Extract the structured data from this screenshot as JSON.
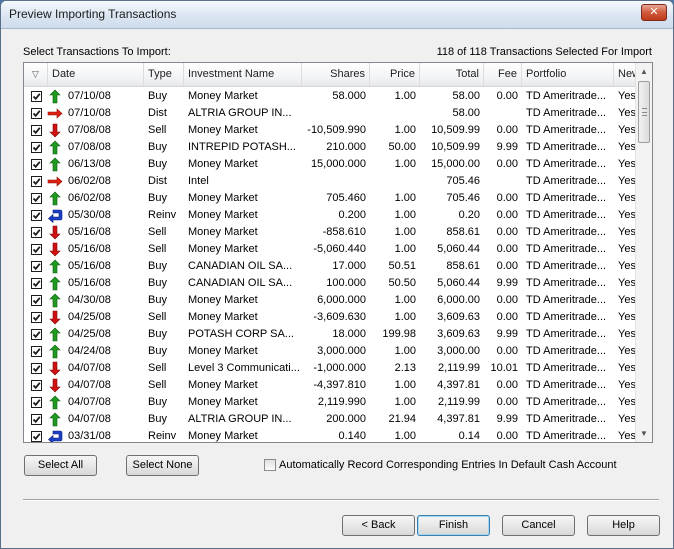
{
  "window": {
    "title": "Preview Importing Transactions",
    "close_label": "✕"
  },
  "labels": {
    "select_prompt": "Select Transactions To Import:",
    "selected_count": "118 of 118 Transactions Selected For Import"
  },
  "columns": [
    "Date",
    "Type",
    "Investment Name",
    "Shares",
    "Price",
    "Total",
    "Fee",
    "Portfolio",
    "New..."
  ],
  "rows": [
    {
      "date": "07/10/08",
      "type": "Buy",
      "icon": "buy-up-arrow-icon",
      "name": "Money Market",
      "shares": "58.000",
      "price": "1.00",
      "total": "58.00",
      "fee": "0.00",
      "portfolio": "TD Ameritrade...",
      "new": "Yes ..."
    },
    {
      "date": "07/10/08",
      "type": "Dist",
      "icon": "dist-right-arrow-icon",
      "name": "ALTRIA GROUP IN...",
      "shares": "",
      "price": "",
      "total": "58.00",
      "fee": "",
      "portfolio": "TD Ameritrade...",
      "new": "Yes ..."
    },
    {
      "date": "07/08/08",
      "type": "Sell",
      "icon": "sell-down-arrow-icon",
      "name": "Money Market",
      "shares": "-10,509.990",
      "price": "1.00",
      "total": "10,509.99",
      "fee": "0.00",
      "portfolio": "TD Ameritrade...",
      "new": "Yes ..."
    },
    {
      "date": "07/08/08",
      "type": "Buy",
      "icon": "buy-up-arrow-icon",
      "name": "INTREPID POTASH...",
      "shares": "210.000",
      "price": "50.00",
      "total": "10,509.99",
      "fee": "9.99",
      "portfolio": "TD Ameritrade...",
      "new": "Yes ..."
    },
    {
      "date": "06/13/08",
      "type": "Buy",
      "icon": "buy-up-arrow-icon",
      "name": "Money Market",
      "shares": "15,000.000",
      "price": "1.00",
      "total": "15,000.00",
      "fee": "0.00",
      "portfolio": "TD Ameritrade...",
      "new": "Yes ..."
    },
    {
      "date": "06/02/08",
      "type": "Dist",
      "icon": "dist-right-arrow-icon",
      "name": "Intel",
      "shares": "",
      "price": "",
      "total": "705.46",
      "fee": "",
      "portfolio": "TD Ameritrade...",
      "new": "Yes ..."
    },
    {
      "date": "06/02/08",
      "type": "Buy",
      "icon": "buy-up-arrow-icon",
      "name": "Money Market",
      "shares": "705.460",
      "price": "1.00",
      "total": "705.46",
      "fee": "0.00",
      "portfolio": "TD Ameritrade...",
      "new": "Yes ..."
    },
    {
      "date": "05/30/08",
      "type": "Reinv",
      "icon": "reinvest-arrow-icon",
      "name": "Money Market",
      "shares": "0.200",
      "price": "1.00",
      "total": "0.20",
      "fee": "0.00",
      "portfolio": "TD Ameritrade...",
      "new": "Yes ..."
    },
    {
      "date": "05/16/08",
      "type": "Sell",
      "icon": "sell-down-arrow-icon",
      "name": "Money Market",
      "shares": "-858.610",
      "price": "1.00",
      "total": "858.61",
      "fee": "0.00",
      "portfolio": "TD Ameritrade...",
      "new": "Yes ..."
    },
    {
      "date": "05/16/08",
      "type": "Sell",
      "icon": "sell-down-arrow-icon",
      "name": "Money Market",
      "shares": "-5,060.440",
      "price": "1.00",
      "total": "5,060.44",
      "fee": "0.00",
      "portfolio": "TD Ameritrade...",
      "new": "Yes ..."
    },
    {
      "date": "05/16/08",
      "type": "Buy",
      "icon": "buy-up-arrow-icon",
      "name": "CANADIAN OIL SA...",
      "shares": "17.000",
      "price": "50.51",
      "total": "858.61",
      "fee": "0.00",
      "portfolio": "TD Ameritrade...",
      "new": "Yes ..."
    },
    {
      "date": "05/16/08",
      "type": "Buy",
      "icon": "buy-up-arrow-icon",
      "name": "CANADIAN OIL SA...",
      "shares": "100.000",
      "price": "50.50",
      "total": "5,060.44",
      "fee": "9.99",
      "portfolio": "TD Ameritrade...",
      "new": "Yes ..."
    },
    {
      "date": "04/30/08",
      "type": "Buy",
      "icon": "buy-up-arrow-icon",
      "name": "Money Market",
      "shares": "6,000.000",
      "price": "1.00",
      "total": "6,000.00",
      "fee": "0.00",
      "portfolio": "TD Ameritrade...",
      "new": "Yes ..."
    },
    {
      "date": "04/25/08",
      "type": "Sell",
      "icon": "sell-down-arrow-icon",
      "name": "Money Market",
      "shares": "-3,609.630",
      "price": "1.00",
      "total": "3,609.63",
      "fee": "0.00",
      "portfolio": "TD Ameritrade...",
      "new": "Yes ..."
    },
    {
      "date": "04/25/08",
      "type": "Buy",
      "icon": "buy-up-arrow-icon",
      "name": "POTASH CORP SA...",
      "shares": "18.000",
      "price": "199.98",
      "total": "3,609.63",
      "fee": "9.99",
      "portfolio": "TD Ameritrade...",
      "new": "Yes ..."
    },
    {
      "date": "04/24/08",
      "type": "Buy",
      "icon": "buy-up-arrow-icon",
      "name": "Money Market",
      "shares": "3,000.000",
      "price": "1.00",
      "total": "3,000.00",
      "fee": "0.00",
      "portfolio": "TD Ameritrade...",
      "new": "Yes ..."
    },
    {
      "date": "04/07/08",
      "type": "Sell",
      "icon": "sell-down-arrow-icon",
      "name": "Level 3 Communicati...",
      "shares": "-1,000.000",
      "price": "2.13",
      "total": "2,119.99",
      "fee": "10.01",
      "portfolio": "TD Ameritrade...",
      "new": "Yes ..."
    },
    {
      "date": "04/07/08",
      "type": "Sell",
      "icon": "sell-down-arrow-icon",
      "name": "Money Market",
      "shares": "-4,397.810",
      "price": "1.00",
      "total": "4,397.81",
      "fee": "0.00",
      "portfolio": "TD Ameritrade...",
      "new": "Yes ..."
    },
    {
      "date": "04/07/08",
      "type": "Buy",
      "icon": "buy-up-arrow-icon",
      "name": "Money Market",
      "shares": "2,119.990",
      "price": "1.00",
      "total": "2,119.99",
      "fee": "0.00",
      "portfolio": "TD Ameritrade...",
      "new": "Yes ..."
    },
    {
      "date": "04/07/08",
      "type": "Buy",
      "icon": "buy-up-arrow-icon",
      "name": "ALTRIA GROUP IN...",
      "shares": "200.000",
      "price": "21.94",
      "total": "4,397.81",
      "fee": "9.99",
      "portfolio": "TD Ameritrade...",
      "new": "Yes ..."
    },
    {
      "date": "03/31/08",
      "type": "Reinv",
      "icon": "reinvest-arrow-icon",
      "name": "Money Market",
      "shares": "0.140",
      "price": "1.00",
      "total": "0.14",
      "fee": "0.00",
      "portfolio": "TD Ameritrade...",
      "new": "Yes ..."
    }
  ],
  "buttons": {
    "select_all": "Select All",
    "select_none": "Select None",
    "back": "< Back",
    "finish": "Finish",
    "cancel": "Cancel",
    "help": "Help"
  },
  "auto_record": {
    "label": "Automatically Record Corresponding Entries In Default Cash Account",
    "checked": false
  },
  "colors": {
    "buy": "#1f9a1f",
    "sell": "#d01010",
    "dist": "#e02010",
    "reinv": "#1a3fc8",
    "title_bg": "#dbe5f1"
  }
}
